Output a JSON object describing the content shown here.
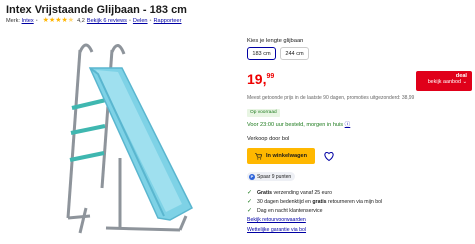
{
  "product": {
    "title": "Intex Vrijstaande Glijbaan - 183 cm",
    "brand_label": "Merk:",
    "brand": "Intex",
    "rating": "4,2",
    "stars_icons": [
      "star-full-icon",
      "star-full-icon",
      "star-full-icon",
      "star-full-icon",
      "star-half-icon"
    ],
    "reviews_link": "Bekijk 6 reviews",
    "share_link": "Delen",
    "report_link": "Rapporteer"
  },
  "options": {
    "label": "Kies je lengte glijbaan",
    "sizes": [
      {
        "label": "183 cm",
        "selected": true
      },
      {
        "label": "244 cm",
        "selected": false
      }
    ]
  },
  "price": {
    "main": "19,",
    "cents": "99",
    "color": "#e00000"
  },
  "deal": {
    "title": "deal",
    "link": "bekijk aanbod",
    "color": "#e0001a"
  },
  "lowest_price_text": "Meest getoonde prijs in de laatste 90 dagen, promoties uitgezonderd: 38,99",
  "stock_badge": "Op voorraad",
  "delivery": {
    "text": "Voor 23:00 uur besteld, morgen in huis",
    "icon": "info-icon"
  },
  "seller": "Verkoop door bol",
  "cart": {
    "label": "In winkelwagen",
    "icon": "cart-icon",
    "color": "#ffb800"
  },
  "points": {
    "icon_text": "P",
    "label": "Spaar 9 punten"
  },
  "usps": [
    {
      "bold": "Gratis",
      "text": " verzending vanaf 25 euro"
    },
    {
      "text1": "30 dagen bedenktijd en ",
      "bold": "gratis",
      "text2": " retourneren via mijn bol"
    },
    {
      "text": "Dag en nacht klantenservice"
    }
  ],
  "links": {
    "returns": "Bekijk retourvoorwaarden",
    "warranty": "Wettelijke garantie via bol"
  }
}
